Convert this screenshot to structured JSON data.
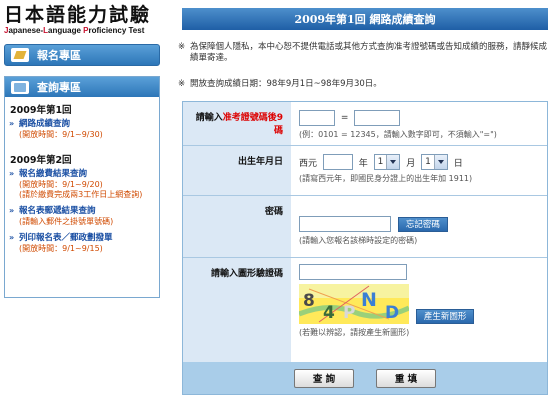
{
  "logo": {
    "title": "日本語能力試驗",
    "subtitle_red": "J",
    "subtitle_rest1": "apanese-",
    "subtitle_red2": "L",
    "subtitle_rest2": "anguage ",
    "subtitle_red3": "P",
    "subtitle_rest3": "roficiency Test"
  },
  "sidebar": {
    "register_label": "報名專區",
    "query_label": "查詢專區",
    "section1": {
      "title": "2009年第1回",
      "items": [
        {
          "link": "網路成績查詢",
          "notes": [
            "(開放時間：9/1~9/30)"
          ]
        }
      ]
    },
    "section2": {
      "title": "2009年第2回",
      "items": [
        {
          "link": "報名繳費結果查詢",
          "notes": [
            "(開放時間：9/1~9/20)",
            "(請於繳費完成兩3工作日上網查詢)"
          ]
        },
        {
          "link": "報名表郵遞結果查詢",
          "notes": [
            "(請輸入郵件之掛號單號碼)"
          ]
        },
        {
          "link": "列印報名表／郵政劃撥單",
          "notes": [
            "(開放時間：9/1~9/15)"
          ]
        }
      ]
    }
  },
  "main": {
    "title": "2009年第1回 網路成績查詢",
    "notice1": "為保障個人隱私，本中心恕不提供電話或其他方式查詢准考證號碼或告知成績的服務，請靜候成績單寄達。",
    "notice2": "開放查詢成績日期：98年9月1日~98年9月30日。",
    "notice_mark": "※"
  },
  "form": {
    "exam_no": {
      "label_prefix": "請輸入",
      "label_red": "准考證號碼後9碼",
      "separator": "=",
      "hint": "(例：0101 = 12345，請輸入數字即可，不須輸入\"=\")"
    },
    "birthday": {
      "label": "出生年月日",
      "prefix": "西元",
      "year_unit": "年",
      "month_value": "1",
      "month_unit": "月",
      "day_value": "1",
      "day_unit": "日",
      "hint": "(請寫西元年，即國民身分證上的出生年加 1911)"
    },
    "password": {
      "label": "密碼",
      "forgot_button": "忘記密碼",
      "hint": "(請輸入您報名該梯時設定的密碼)"
    },
    "captcha": {
      "label": "請輸入圖形驗證碼",
      "chars": [
        "8",
        "4",
        "P",
        "N",
        "D"
      ],
      "new_button": "產生新圖形",
      "hint": "(若難以辨認，請按產生新圖形)"
    },
    "submit_label": "查 詢",
    "reset_label": "重 填"
  },
  "colors": {
    "header_blue": "#2d76b8",
    "label_bg": "#dbe8f5",
    "footer_bg": "#a9cde9",
    "link_blue": "#1a4fa3",
    "note_orange": "#d04a00",
    "required_red": "#dd0000"
  }
}
